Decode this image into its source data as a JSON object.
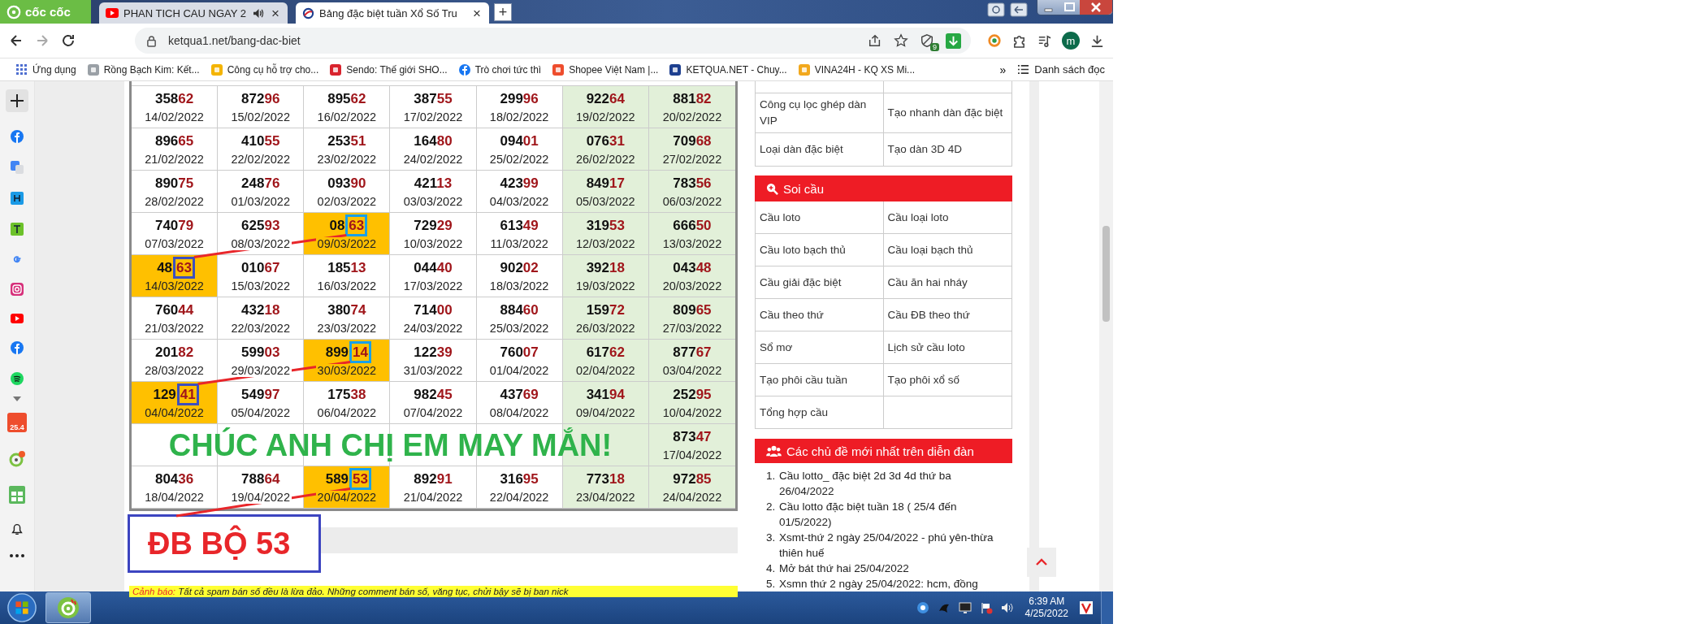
{
  "browser": {
    "brand": "cốc cốc",
    "tabs": [
      {
        "title": "PHAN TICH CAU NGAY 2",
        "kind": "youtube",
        "audio": true,
        "selected": false,
        "close": "×"
      },
      {
        "title": "Bảng đặc biệt tuần Xổ Số Tru",
        "kind": "ketqua",
        "audio": false,
        "selected": true,
        "close": "×"
      }
    ],
    "new_tab": "+"
  },
  "address_bar": {
    "url": "ketqua1.net/bang-dac-biet",
    "shield_badge": "9",
    "avatar_letter": "m"
  },
  "bookmarks": {
    "items": [
      {
        "label": "Ứng dụng",
        "kind": "apps"
      },
      {
        "label": "Rồng Bạch Kim: Kết...",
        "kind": "rbk"
      },
      {
        "label": "Công cụ hỗ trợ cho...",
        "kind": "xs"
      },
      {
        "label": "Sendo: Thế giới SHO...",
        "kind": "sendo"
      },
      {
        "label": "Trò chơi tức thì",
        "kind": "facebook"
      },
      {
        "label": "Shopee Việt Nam |...",
        "kind": "shopee"
      },
      {
        "label": "KETQUA.NET - Chuy...",
        "kind": "ketqua"
      },
      {
        "label": "VINA24H - KQ XS Mi...",
        "kind": "vina"
      }
    ],
    "more": "»",
    "reading_list": "Danh sách đọc"
  },
  "side_panel": {
    "shop_badge": "25.4"
  },
  "page": {
    "table": {
      "columns": [
        {
          "weekend": false
        },
        {
          "weekend": false
        },
        {
          "weekend": false
        },
        {
          "weekend": false
        },
        {
          "weekend": false
        },
        {
          "weekend": true
        },
        {
          "weekend": true
        }
      ],
      "rows": [
        {
          "cells": [
            {
              "prefix": "358",
              "suffix": "62",
              "date": "14/02/2022",
              "highlighted": false
            },
            {
              "prefix": "872",
              "suffix": "96",
              "date": "15/02/2022",
              "highlighted": false
            },
            {
              "prefix": "895",
              "suffix": "62",
              "date": "16/02/2022",
              "highlighted": false
            },
            {
              "prefix": "387",
              "suffix": "55",
              "date": "17/02/2022",
              "highlighted": false
            },
            {
              "prefix": "299",
              "suffix": "96",
              "date": "18/02/2022",
              "highlighted": false
            },
            {
              "prefix": "922",
              "suffix": "64",
              "date": "19/02/2022",
              "highlighted": false
            },
            {
              "prefix": "881",
              "suffix": "82",
              "date": "20/02/2022",
              "highlighted": false
            }
          ]
        },
        {
          "cells": [
            {
              "prefix": "896",
              "suffix": "65",
              "date": "21/02/2022",
              "highlighted": false
            },
            {
              "prefix": "410",
              "suffix": "55",
              "date": "22/02/2022",
              "highlighted": false
            },
            {
              "prefix": "253",
              "suffix": "51",
              "date": "23/02/2022",
              "highlighted": false
            },
            {
              "prefix": "164",
              "suffix": "80",
              "date": "24/02/2022",
              "highlighted": false
            },
            {
              "prefix": "094",
              "suffix": "01",
              "date": "25/02/2022",
              "highlighted": false
            },
            {
              "prefix": "076",
              "suffix": "31",
              "date": "26/02/2022",
              "highlighted": false
            },
            {
              "prefix": "709",
              "suffix": "68",
              "date": "27/02/2022",
              "highlighted": false
            }
          ]
        },
        {
          "cells": [
            {
              "prefix": "890",
              "suffix": "75",
              "date": "28/02/2022",
              "highlighted": false
            },
            {
              "prefix": "248",
              "suffix": "76",
              "date": "01/03/2022",
              "highlighted": false
            },
            {
              "prefix": "093",
              "suffix": "90",
              "date": "02/03/2022",
              "highlighted": false
            },
            {
              "prefix": "421",
              "suffix": "13",
              "date": "03/03/2022",
              "highlighted": false
            },
            {
              "prefix": "423",
              "suffix": "99",
              "date": "04/03/2022",
              "highlighted": false
            },
            {
              "prefix": "849",
              "suffix": "17",
              "date": "05/03/2022",
              "highlighted": false
            },
            {
              "prefix": "783",
              "suffix": "56",
              "date": "06/03/2022",
              "highlighted": false
            }
          ]
        },
        {
          "cells": [
            {
              "prefix": "740",
              "suffix": "79",
              "date": "07/03/2022",
              "highlighted": false
            },
            {
              "prefix": "625",
              "suffix": "93",
              "date": "08/03/2022",
              "highlighted": false
            },
            {
              "prefix": "08",
              "suffix": "63",
              "date": "09/03/2022",
              "highlighted": true,
              "color": "#19a0e8"
            },
            {
              "prefix": "729",
              "suffix": "29",
              "date": "10/03/2022",
              "highlighted": false
            },
            {
              "prefix": "613",
              "suffix": "49",
              "date": "11/03/2022",
              "highlighted": false
            },
            {
              "prefix": "319",
              "suffix": "53",
              "date": "12/03/2022",
              "highlighted": false
            },
            {
              "prefix": "666",
              "suffix": "50",
              "date": "13/03/2022",
              "highlighted": false
            }
          ]
        },
        {
          "cells": [
            {
              "prefix": "48",
              "suffix": "63",
              "date": "14/03/2022",
              "highlighted": true,
              "color": "#3c4fbf"
            },
            {
              "prefix": "010",
              "suffix": "67",
              "date": "15/03/2022",
              "highlighted": false
            },
            {
              "prefix": "185",
              "suffix": "13",
              "date": "16/03/2022",
              "highlighted": false
            },
            {
              "prefix": "044",
              "suffix": "40",
              "date": "17/03/2022",
              "highlighted": false
            },
            {
              "prefix": "902",
              "suffix": "02",
              "date": "18/03/2022",
              "highlighted": false
            },
            {
              "prefix": "392",
              "suffix": "18",
              "date": "19/03/2022",
              "highlighted": false
            },
            {
              "prefix": "043",
              "suffix": "48",
              "date": "20/03/2022",
              "highlighted": false
            }
          ]
        },
        {
          "cells": [
            {
              "prefix": "760",
              "suffix": "44",
              "date": "21/03/2022",
              "highlighted": false
            },
            {
              "prefix": "432",
              "suffix": "18",
              "date": "22/03/2022",
              "highlighted": false
            },
            {
              "prefix": "380",
              "suffix": "74",
              "date": "23/03/2022",
              "highlighted": false
            },
            {
              "prefix": "714",
              "suffix": "00",
              "date": "24/03/2022",
              "highlighted": false
            },
            {
              "prefix": "884",
              "suffix": "60",
              "date": "25/03/2022",
              "highlighted": false
            },
            {
              "prefix": "159",
              "suffix": "72",
              "date": "26/03/2022",
              "highlighted": false
            },
            {
              "prefix": "809",
              "suffix": "65",
              "date": "27/03/2022",
              "highlighted": false
            }
          ]
        },
        {
          "cells": [
            {
              "prefix": "201",
              "suffix": "82",
              "date": "28/03/2022",
              "highlighted": false
            },
            {
              "prefix": "599",
              "suffix": "03",
              "date": "29/03/2022",
              "highlighted": false
            },
            {
              "prefix": "899",
              "suffix": "14",
              "date": "30/03/2022",
              "highlighted": true,
              "color": "#19a0e8"
            },
            {
              "prefix": "122",
              "suffix": "39",
              "date": "31/03/2022",
              "highlighted": false
            },
            {
              "prefix": "760",
              "suffix": "07",
              "date": "01/04/2022",
              "highlighted": false
            },
            {
              "prefix": "617",
              "suffix": "62",
              "date": "02/04/2022",
              "highlighted": false
            },
            {
              "prefix": "877",
              "suffix": "67",
              "date": "03/04/2022",
              "highlighted": false
            }
          ]
        },
        {
          "cells": [
            {
              "prefix": "129",
              "suffix": "41",
              "date": "04/04/2022",
              "highlighted": true,
              "color": "#3c4fbf"
            },
            {
              "prefix": "549",
              "suffix": "97",
              "date": "05/04/2022",
              "highlighted": false
            },
            {
              "prefix": "175",
              "suffix": "38",
              "date": "06/04/2022",
              "highlighted": false
            },
            {
              "prefix": "982",
              "suffix": "45",
              "date": "07/04/2022",
              "highlighted": false
            },
            {
              "prefix": "437",
              "suffix": "69",
              "date": "08/04/2022",
              "highlighted": false
            },
            {
              "prefix": "341",
              "suffix": "94",
              "date": "09/04/2022",
              "highlighted": false
            },
            {
              "prefix": "252",
              "suffix": "95",
              "date": "10/04/2022",
              "highlighted": false
            }
          ]
        },
        {
          "cells": [
            {
              "highlighted": false
            },
            {
              "highlighted": false
            },
            {
              "highlighted": false
            },
            {
              "highlighted": false
            },
            {
              "highlighted": false
            },
            {
              "highlighted": false
            },
            {
              "prefix": "873",
              "suffix": "47",
              "date": "17/04/2022",
              "highlighted": false
            }
          ]
        },
        {
          "cells": [
            {
              "prefix": "804",
              "suffix": "36",
              "date": "18/04/2022",
              "highlighted": false
            },
            {
              "prefix": "788",
              "suffix": "64",
              "date": "19/04/2022",
              "highlighted": false
            },
            {
              "prefix": "589",
              "suffix": "53",
              "date": "20/04/2022",
              "highlighted": true,
              "color": "#19a0e8"
            },
            {
              "prefix": "892",
              "suffix": "91",
              "date": "21/04/2022",
              "highlighted": false
            },
            {
              "prefix": "316",
              "suffix": "95",
              "date": "22/04/2022",
              "highlighted": false
            },
            {
              "prefix": "773",
              "suffix": "18",
              "date": "23/04/2022",
              "highlighted": false
            },
            {
              "prefix": "972",
              "suffix": "85",
              "date": "24/04/2022",
              "highlighted": false
            }
          ]
        }
      ]
    },
    "overlay_text": "CHÚC ANH CHỊ EM MAY MẮN!",
    "result_label": "ĐB BỘ 53",
    "warning": {
      "label": "Cảnh báo:",
      "text": "Tất cả spam bán số đều là lừa đảo. Những comment bán số, văng tục, chửi bậy sẽ bị ban nick"
    },
    "sidebar": {
      "tools": [
        [
          "Công cụ lọc ghép dàn VIP",
          "Tạo nhanh dàn đặc biệt"
        ],
        [
          "Loại dàn đặc biệt",
          "Tạo dàn 3D 4D"
        ]
      ],
      "soi_cau": {
        "title": "Soi cầu",
        "items": [
          "Cầu loto",
          "Cầu loại loto",
          "Cầu loto bạch thủ",
          "Cầu loại bạch thủ",
          "Cầu giải đặc biệt",
          "Cầu ăn hai nháy",
          "Cầu theo thứ",
          "Cầu ĐB theo thứ",
          "Sổ mơ",
          "Lịch sử cầu loto",
          "Tạo phôi cầu tuần",
          "Tạo phôi xổ số",
          "Tổng hợp cầu"
        ]
      },
      "forum": {
        "title": "Các chủ đề mới nhất trên diễn đàn",
        "topics": [
          {
            "index": "1.",
            "text": "Cầu lotto_ đặc biệt 2d 3d 4d thứ ba 26/04/2022"
          },
          {
            "index": "2.",
            "text": "Cầu lotto đặc biệt tuần 18 ( 25/4 đến 01/5/2022)"
          },
          {
            "index": "3.",
            "text": "Xsmt-thứ 2 ngày 25/04/2022 - phú yên-thừa thiên huế"
          },
          {
            "index": "4.",
            "text": "Mở bát thứ hai 25/04/2022"
          },
          {
            "index": "5.",
            "text": "Xsmn thứ 2 ngày 25/04/2022: hcm, đồng"
          }
        ]
      }
    }
  },
  "taskbar": {
    "time": "6:39 AM",
    "date": "4/25/2022"
  }
}
